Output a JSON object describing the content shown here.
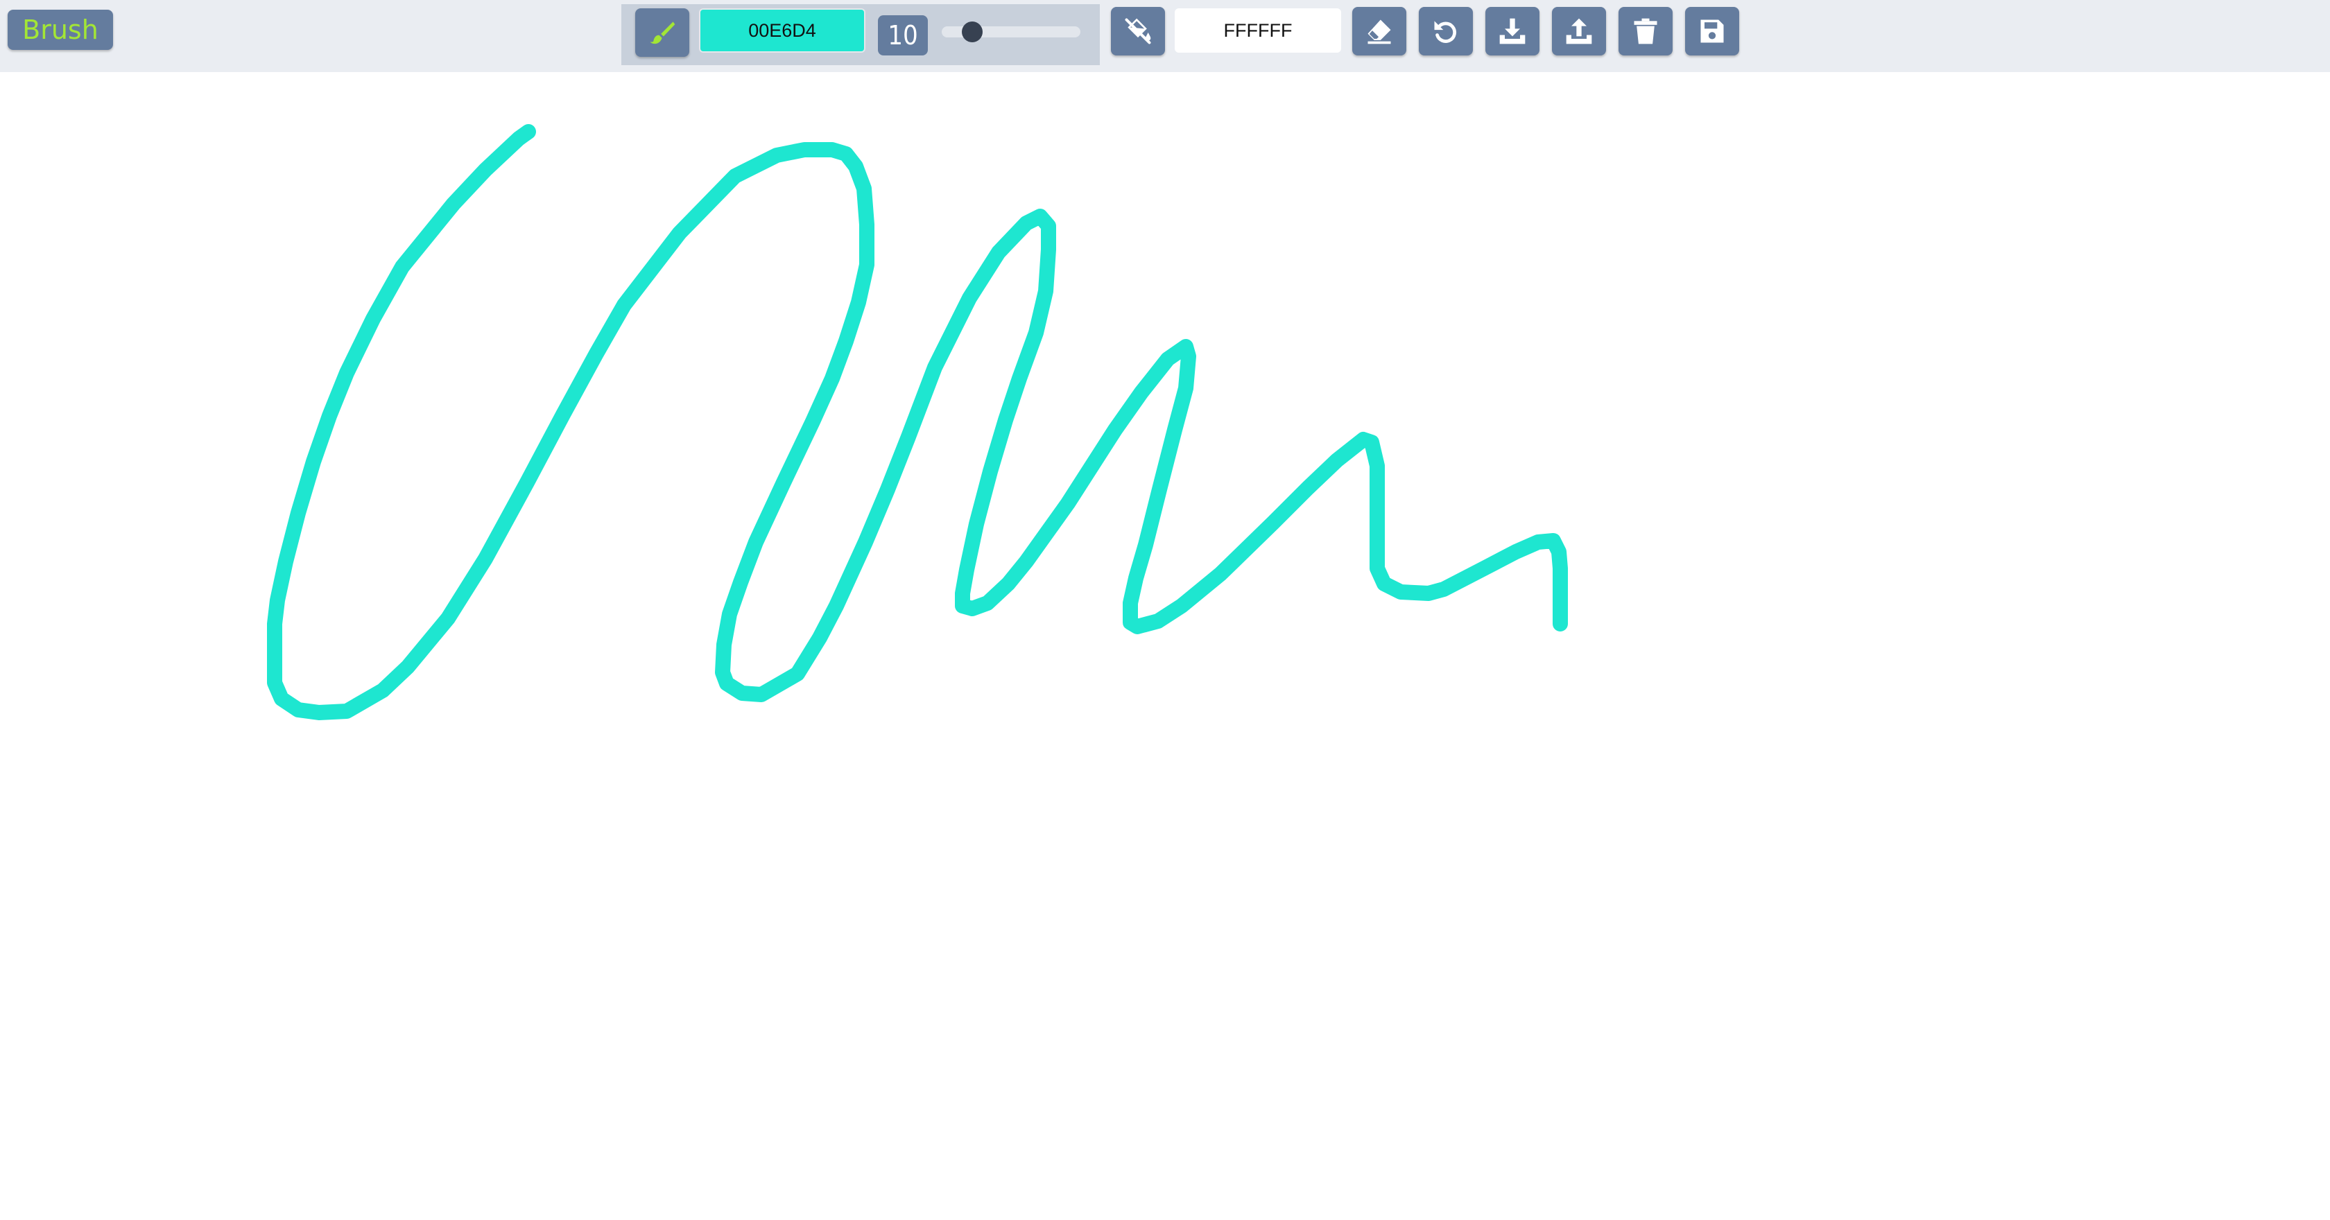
{
  "mode": {
    "label": "Brush"
  },
  "brush": {
    "color_hex_label": "00E6D4",
    "color": "#1EE6D0",
    "size_label": "10",
    "size_fraction": 0.22
  },
  "fill": {
    "color_hex_label": "FFFFFF",
    "color": "#FFFFFF"
  },
  "theme": {
    "button_bg": "#647C9E",
    "accent": "#A3E635",
    "toolbar_bg": "#EAEDF2"
  },
  "icons": {
    "brush": "paint-brush-icon",
    "fill": "fill-bucket-icon",
    "eraser": "eraser-icon",
    "undo": "undo-icon",
    "download": "download-icon",
    "upload": "upload-icon",
    "clear": "trash-icon",
    "save": "save-icon"
  }
}
